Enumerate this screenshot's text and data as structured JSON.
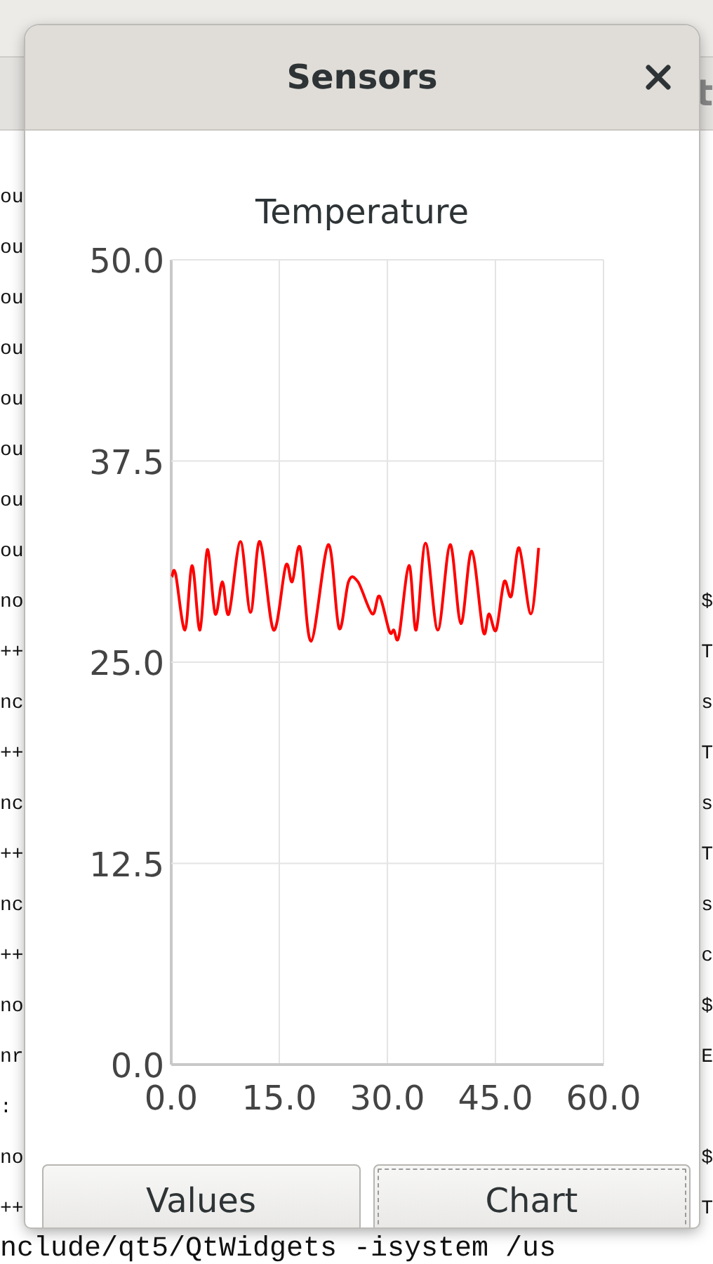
{
  "terminal": {
    "tab_label": "t",
    "lines": [
      {
        "left": "ou"
      },
      {
        "left": "ou"
      },
      {
        "left": "ou"
      },
      {
        "left": "ou"
      },
      {
        "left": "ou"
      },
      {
        "left": "ou"
      },
      {
        "left": "ou"
      },
      {
        "left": "ou"
      },
      {
        "left": "no",
        "right": "$"
      },
      {
        "left": "++",
        "right": "T"
      },
      {
        "left": "nc",
        "right": "s"
      },
      {
        "left": "++",
        "right": "T"
      },
      {
        "left": "nc",
        "right": "s"
      },
      {
        "left": "++",
        "right": "T"
      },
      {
        "left": "nc",
        "right": "s"
      },
      {
        "left": "++",
        "right": "c"
      },
      {
        "left": "no",
        "right": "$"
      },
      {
        "left": "nr",
        "right": "E"
      },
      {
        "left": ":"
      },
      {
        "left": "no",
        "right": "$"
      },
      {
        "left": "++",
        "right": "T"
      }
    ],
    "bottom_line": "nclude/qt5/QtWidgets -isystem /us"
  },
  "dialog": {
    "title": "Sensors",
    "chart_data": {
      "type": "line",
      "title": "Temperature",
      "xlim": [
        0,
        60
      ],
      "ylim": [
        0,
        50
      ],
      "xticks": [
        {
          "value": 0,
          "label": "0.0"
        },
        {
          "value": 15,
          "label": "15.0"
        },
        {
          "value": 30,
          "label": "30.0"
        },
        {
          "value": 45,
          "label": "45.0"
        },
        {
          "value": 60,
          "label": "60.0"
        }
      ],
      "yticks": [
        {
          "value": 0,
          "label": "0.0"
        },
        {
          "value": 12.5,
          "label": "12.5"
        },
        {
          "value": 25,
          "label": "25.0"
        },
        {
          "value": 37.5,
          "label": "37.5"
        },
        {
          "value": 50,
          "label": "50.0"
        }
      ],
      "x": [
        0.1,
        0.6,
        1.9,
        2.9,
        4.0,
        5.0,
        6.1,
        7.1,
        8.0,
        9.6,
        11.0,
        12.3,
        14.2,
        15.9,
        16.8,
        17.9,
        19.4,
        21.8,
        23.3,
        24.6,
        25.9,
        27.9,
        28.9,
        30.3,
        30.9,
        31.6,
        33.0,
        34.0,
        35.3,
        37.0,
        38.7,
        40.2,
        41.7,
        43.3,
        44.1,
        45.1,
        46.2,
        47.2,
        48.3,
        49.9,
        51.0
      ],
      "grid": true,
      "series": [
        {
          "color": "#ff0000",
          "values": [
            30.3,
            30.5,
            27.0,
            31.0,
            27.0,
            32.0,
            28.0,
            30.0,
            28.0,
            32.5,
            28.1,
            32.5,
            27.0,
            31.0,
            30.0,
            32.1,
            26.3,
            32.3,
            27.1,
            30.0,
            30.0,
            28.0,
            29.1,
            26.9,
            27.0,
            26.6,
            31.0,
            27.0,
            32.4,
            27.0,
            32.3,
            27.4,
            31.9,
            26.9,
            28.0,
            27.0,
            30.0,
            29.1,
            32.1,
            28.0,
            32.1
          ]
        }
      ]
    },
    "buttons": [
      {
        "label": "Values",
        "focused": false
      },
      {
        "label": "Chart",
        "focused": true
      }
    ]
  }
}
